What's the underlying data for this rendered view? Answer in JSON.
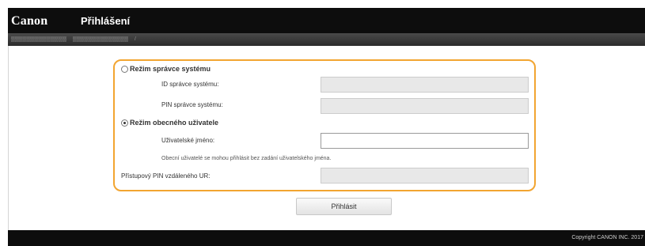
{
  "header": {
    "logo": "Canon",
    "title": "Přihlášení"
  },
  "form": {
    "admin_mode_label": "Režim správce systému",
    "admin_id_label": "ID správce systému:",
    "admin_pin_label": "PIN správce systému:",
    "general_mode_label": "Režim obecného uživatele",
    "username_label": "Uživatelské jméno:",
    "username_value": "",
    "general_note": "Obecní uživatelé se mohou přihlásit bez zadání uživatelského jména.",
    "remote_pin_label": "Přístupový PIN vzdáleného UR:",
    "selected_mode": "general"
  },
  "actions": {
    "login_label": "Přihlásit"
  },
  "footer": {
    "copyright": "Copyright CANON INC. 2017"
  }
}
